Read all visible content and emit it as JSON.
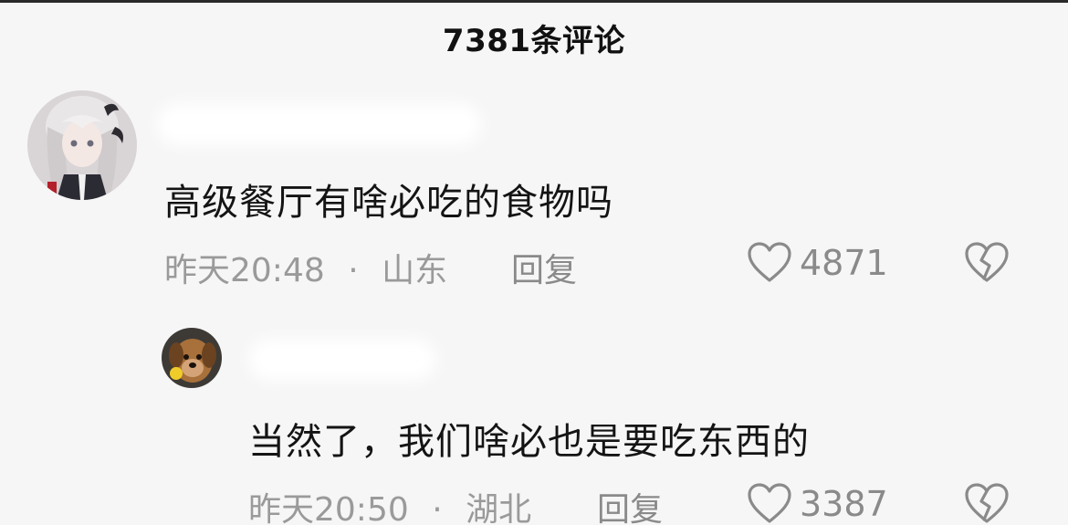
{
  "header": {
    "title": "7381条评论"
  },
  "comments": [
    {
      "text": "高级餐厅有啥必吃的食物吗",
      "time": "昨天20:48",
      "separator": "·",
      "location": "山东",
      "reply_label": "回复",
      "likes": "4871",
      "avatar_icon": "anime-girl-avatar"
    },
    {
      "text": "当然了，我们啥必也是要吃东西的",
      "time": "昨天20:50",
      "separator": "·",
      "location": "湖北",
      "reply_label": "回复",
      "likes": "3387",
      "avatar_icon": "dog-avatar"
    }
  ],
  "colors": {
    "background": "#f6f6f6",
    "text_primary": "#141414",
    "text_secondary": "#9a9a9a",
    "icon_gray": "#8a8a8a"
  }
}
